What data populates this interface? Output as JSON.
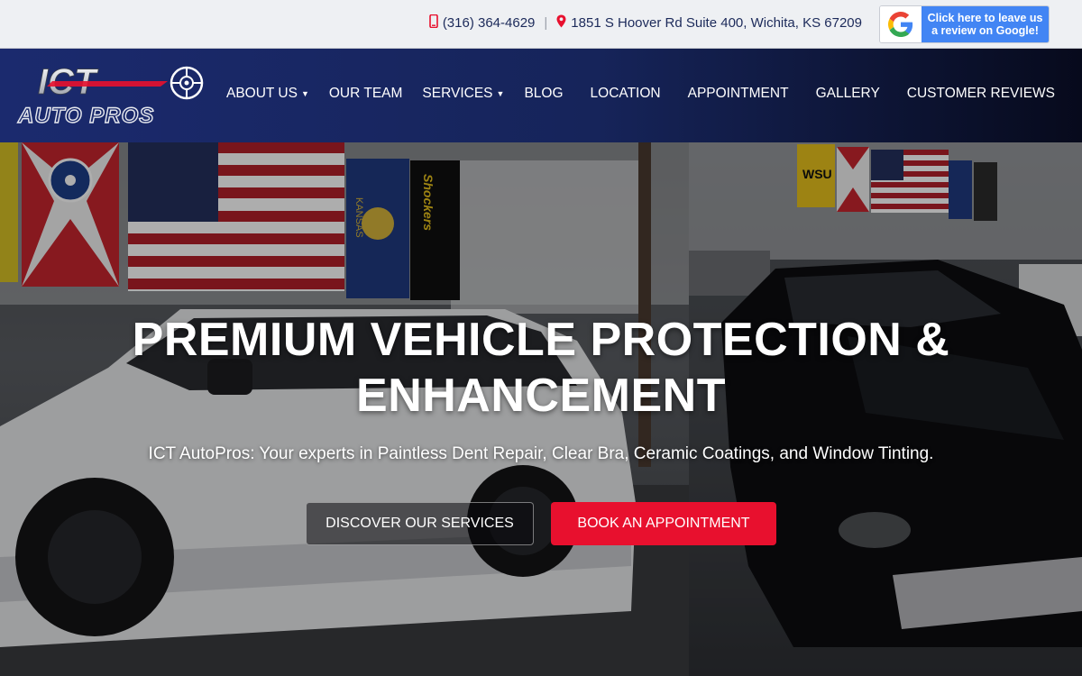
{
  "topbar": {
    "phone": "(316) 364-4629",
    "separator": "|",
    "address": "1851 S Hoover Rd Suite 400, Wichita, KS 67209",
    "review_button": "Click here to leave us a review on Google!"
  },
  "brand": {
    "logo_line1": "ICT",
    "logo_line2": "AUTO PROS"
  },
  "nav": {
    "items": [
      {
        "label": "ABOUT US",
        "dropdown": true
      },
      {
        "label": "OUR TEAM",
        "dropdown": false
      },
      {
        "label": "SERVICES",
        "dropdown": true
      },
      {
        "label": "BLOG",
        "dropdown": false
      },
      {
        "label": "LOCATION",
        "dropdown": false
      },
      {
        "label": "APPOINTMENT",
        "dropdown": false
      },
      {
        "label": "GALLERY",
        "dropdown": false
      },
      {
        "label": "CUSTOMER REVIEWS",
        "dropdown": false
      }
    ]
  },
  "hero": {
    "title": "PREMIUM VEHICLE PROTECTION & ENHANCEMENT",
    "subtitle": "ICT AutoPros: Your experts in Paintless Dent Repair, Clear Bra, Ceramic Coatings, and Window Tinting.",
    "cta_primary": "DISCOVER OUR SERVICES",
    "cta_secondary": "BOOK AN APPOINTMENT",
    "flag_text_kansas": "KANSAS",
    "flag_text_shockers": "Shockers",
    "flag_text_wsu": "WSU"
  },
  "colors": {
    "accent_red": "#e8102e",
    "navy": "#1b2a6e",
    "google_blue": "#4285f4"
  }
}
